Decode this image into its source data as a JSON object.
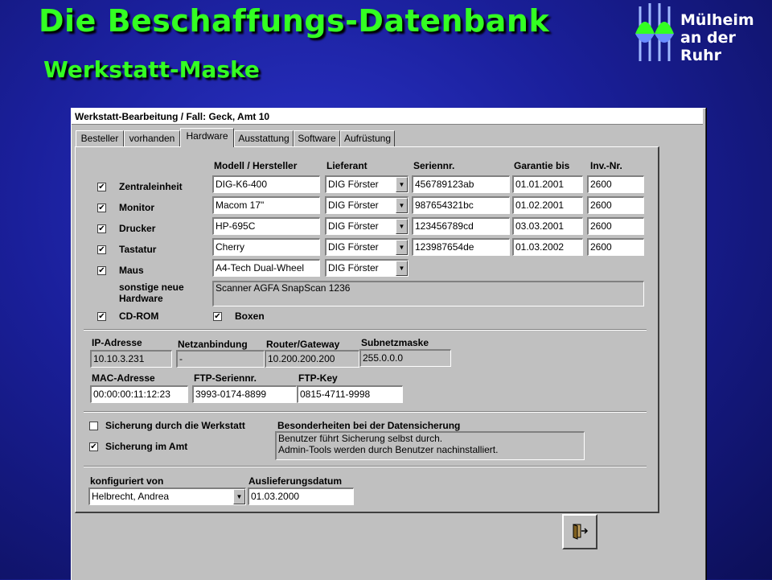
{
  "slide": {
    "title": "Die Beschaffungs-Datenbank",
    "subtitle": "Werkstatt-Maske",
    "logo_line1": "Mülheim",
    "logo_line2": "an der Ruhr"
  },
  "window": {
    "title": "Werkstatt-Bearbeitung / Fall: Geck, Amt 10",
    "tabs": [
      "Besteller",
      "vorhanden",
      "Hardware",
      "Ausstattung",
      "Software",
      "Aufrüstung"
    ],
    "active_tab": "Hardware"
  },
  "hardware": {
    "headers": {
      "model": "Modell / Hersteller",
      "supplier": "Lieferant",
      "serial": "Seriennr.",
      "warranty": "Garantie bis",
      "inventory": "Inv.-Nr."
    },
    "rows": [
      {
        "checked": true,
        "label": "Zentraleinheit",
        "model": "DIG-K6-400",
        "supplier": "DIG Förster",
        "serial": "456789123ab",
        "warranty": "01.01.2001",
        "inventory": "2600"
      },
      {
        "checked": true,
        "label": "Monitor",
        "model": "Macom 17\"",
        "supplier": "DIG Förster",
        "serial": "987654321bc",
        "warranty": "01.02.2001",
        "inventory": "2600"
      },
      {
        "checked": true,
        "label": "Drucker",
        "model": "HP-695C",
        "supplier": "DIG Förster",
        "serial": "123456789cd",
        "warranty": "03.03.2001",
        "inventory": "2600"
      },
      {
        "checked": true,
        "label": "Tastatur",
        "model": "Cherry",
        "supplier": "DIG Förster",
        "serial": "123987654de",
        "warranty": "01.03.2002",
        "inventory": "2600"
      },
      {
        "checked": true,
        "label": "Maus",
        "model": "A4-Tech Dual-Wheel",
        "supplier": "DIG Förster"
      }
    ],
    "other_label_1": "sonstige neue",
    "other_label_2": "Hardware",
    "other_value": "Scanner AGFA SnapScan 1236",
    "cdrom_label": "CD-ROM",
    "cdrom_checked": true,
    "boxen_label": "Boxen",
    "boxen_checked": true
  },
  "network": {
    "ip_label": "IP-Adresse",
    "ip": "10.10.3.231",
    "net_label": "Netzanbindung",
    "net": "-",
    "router_label": "Router/Gateway",
    "router": "10.200.200.200",
    "subnet_label": "Subnetzmaske",
    "subnet": "255.0.0.0",
    "mac_label": "MAC-Adresse",
    "mac": "00:00:00:11:12:23",
    "ftp_serial_label": "FTP-Seriennr.",
    "ftp_serial": "3993-0174-8899",
    "ftp_key_label": "FTP-Key",
    "ftp_key": "0815-4711-9998"
  },
  "backup": {
    "workshop_label": "Sicherung durch die Werkstatt",
    "workshop_checked": false,
    "office_label": "Sicherung im Amt",
    "office_checked": true,
    "notes_label": "Besonderheiten bei der Datensicherung",
    "notes_line1": "Benutzer führt Sicherung selbst durch.",
    "notes_line2": "Admin-Tools werden durch Benutzer nachinstalliert."
  },
  "config": {
    "configured_by_label": "konfiguriert von",
    "configured_by": "Helbrecht, Andrea",
    "delivery_label": "Auslieferungsdatum",
    "delivery": "01.03.2000"
  },
  "icons": {
    "exit": "exit-door-icon",
    "checkmark": "✔",
    "dropdown": "▼"
  },
  "colors": {
    "title_green": "#33ff22",
    "background_blue": "#1a1f9a",
    "window_gray": "#c0c0c0"
  }
}
